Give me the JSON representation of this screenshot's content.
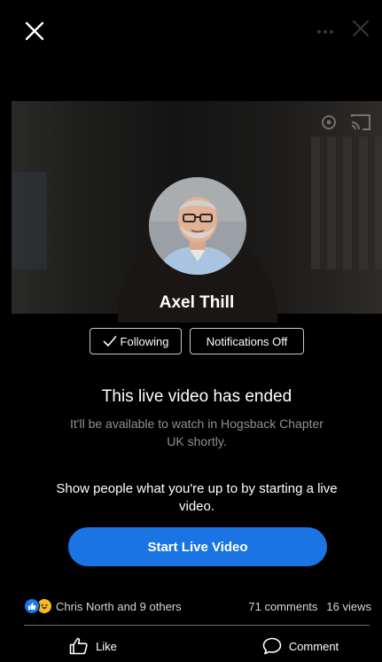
{
  "topbar": {
    "close_icon": "close-icon",
    "more_icon": "more-dots-icon",
    "secondary_close_icon": "close-icon"
  },
  "video": {
    "overlay_icons": [
      "settings-icon",
      "cast-icon"
    ]
  },
  "profile": {
    "name": "Axel Thill"
  },
  "actions": {
    "following_label": "Following",
    "notifications_label": "Notifications Off"
  },
  "ended": {
    "title": "This live video has ended",
    "subtitle": "It'll be available to watch in Hogsback Chapter UK shortly."
  },
  "promo": {
    "text": "Show people what you're up to by starting a live video.",
    "button_label": "Start Live Video"
  },
  "stats": {
    "reactions_text": "Chris North and 9 others",
    "comments_text": "71 comments",
    "views_text": "16 views"
  },
  "footer": {
    "like_label": "Like",
    "comment_label": "Comment"
  },
  "colors": {
    "accent": "#1b74e4",
    "like_reaction": "#1877f2",
    "haha_reaction": "#f7b928"
  }
}
